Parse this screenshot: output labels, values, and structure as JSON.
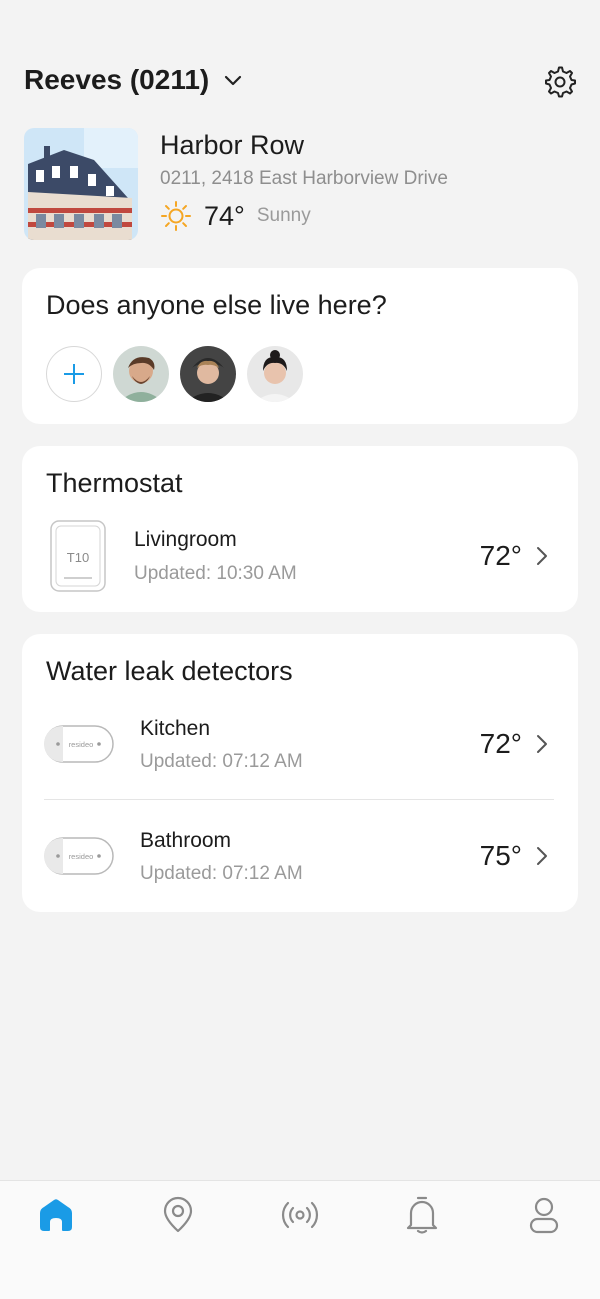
{
  "header": {
    "home_name": "Reeves (0211)",
    "icons": {
      "dropdown": "chevron-down-icon",
      "settings": "gear-icon"
    }
  },
  "property": {
    "title": "Harbor Row",
    "address": "0211, 2418 East Harborview Drive",
    "weather": {
      "temp": "74°",
      "condition": "Sunny",
      "icon": "sun-icon"
    }
  },
  "occupants": {
    "title": "Does anyone else live here?",
    "add_icon": "plus-icon",
    "avatars": [
      "avatar-1",
      "avatar-2",
      "avatar-3"
    ]
  },
  "thermostat": {
    "title": "Thermostat",
    "devices": [
      {
        "name": "Livingroom",
        "updated": "Updated: 10:30 AM",
        "temp": "72°",
        "device_label": "T10"
      }
    ]
  },
  "leak_detectors": {
    "title": "Water leak detectors",
    "devices": [
      {
        "name": "Kitchen",
        "updated": "Updated: 07:12 AM",
        "temp": "72°",
        "device_label": "resideo"
      },
      {
        "name": "Bathroom",
        "updated": "Updated: 07:12 AM",
        "temp": "75°",
        "device_label": "resideo"
      }
    ]
  },
  "nav": {
    "items": [
      "home-icon",
      "location-pin-icon",
      "signal-icon",
      "bell-icon",
      "user-icon"
    ],
    "active": "home-icon"
  },
  "colors": {
    "accent": "#1a9be6",
    "sun": "#f5a623",
    "background": "#f3f3f3"
  }
}
